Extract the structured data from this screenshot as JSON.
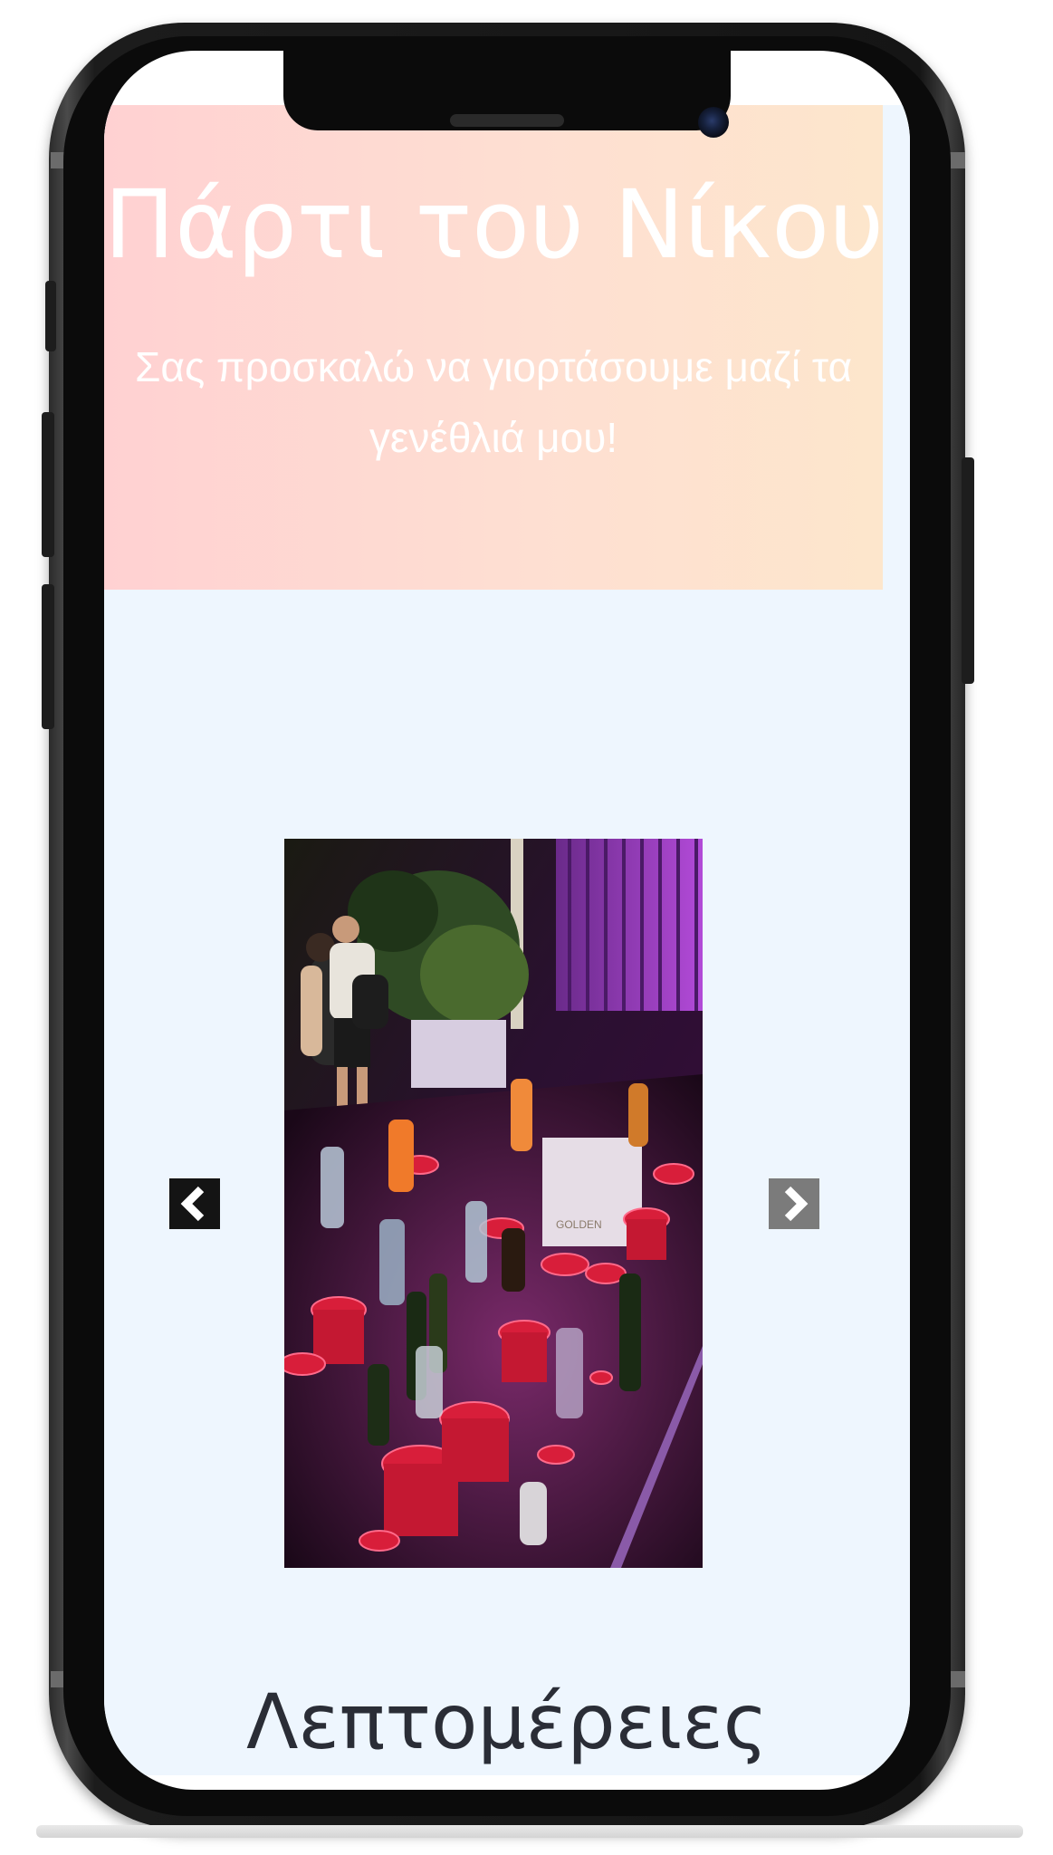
{
  "page": {
    "title": "Πάρτι του Νίκου",
    "subtitle": "Σας προσκαλώ να γιορτάσουμε μαζί τα γενέθλιά μου!"
  },
  "carousel": {
    "prev_icon": "chevron-left-icon",
    "next_icon": "chevron-right-icon",
    "slide": {
      "description_icon": "party-photo"
    }
  },
  "details": {
    "heading": "Λεπτομέρειες"
  },
  "colors": {
    "hero_gradient_start": "#ffd1d2",
    "hero_gradient_end": "#fde6cc",
    "page_background": "#eef6fe",
    "heading_text": "#2a2d36",
    "prev_button": "#141414",
    "next_button": "#7b7b7b"
  }
}
